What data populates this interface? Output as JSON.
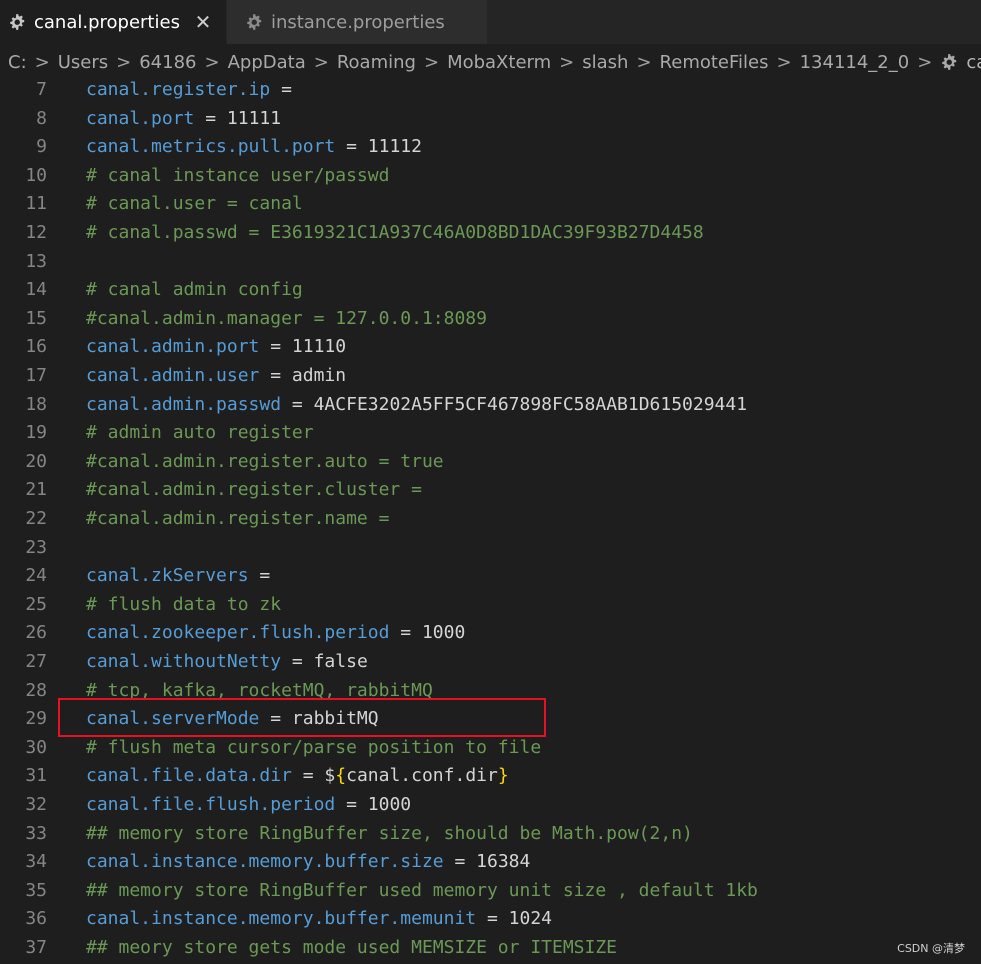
{
  "tabs": [
    {
      "label": "canal.properties",
      "active": true,
      "icon": "gear-icon",
      "close": "✕"
    },
    {
      "label": "instance.properties",
      "active": false,
      "icon": "gear-icon"
    }
  ],
  "breadcrumb": [
    "C:",
    "Users",
    "64186",
    "AppData",
    "Roaming",
    "MobaXterm",
    "slash",
    "RemoteFiles",
    "134114_2_0",
    "canal.proper"
  ],
  "breadcrumb_separator": ">",
  "lines": [
    {
      "n": "7",
      "key": "canal.register.ip",
      "eq": " =",
      "val": ""
    },
    {
      "n": "8",
      "key": "canal.port",
      "eq": " = ",
      "val": "11111"
    },
    {
      "n": "9",
      "key": "canal.metrics.pull.port",
      "eq": " = ",
      "val": "11112"
    },
    {
      "n": "10",
      "comment": "# canal instance user/passwd"
    },
    {
      "n": "11",
      "comment": "# canal.user = canal"
    },
    {
      "n": "12",
      "comment": "# canal.passwd = E3619321C1A937C46A0D8BD1DAC39F93B27D4458"
    },
    {
      "n": "13"
    },
    {
      "n": "14",
      "comment": "# canal admin config"
    },
    {
      "n": "15",
      "comment": "#canal.admin.manager = 127.0.0.1:8089"
    },
    {
      "n": "16",
      "key": "canal.admin.port",
      "eq": " = ",
      "val": "11110"
    },
    {
      "n": "17",
      "key": "canal.admin.user",
      "eq": " = ",
      "val": "admin"
    },
    {
      "n": "18",
      "key": "canal.admin.passwd",
      "eq": " = ",
      "val": "4ACFE3202A5FF5CF467898FC58AAB1D615029441"
    },
    {
      "n": "19",
      "comment": "# admin auto register"
    },
    {
      "n": "20",
      "comment": "#canal.admin.register.auto = true"
    },
    {
      "n": "21",
      "comment": "#canal.admin.register.cluster ="
    },
    {
      "n": "22",
      "comment": "#canal.admin.register.name ="
    },
    {
      "n": "23"
    },
    {
      "n": "24",
      "key": "canal.zkServers",
      "eq": " =",
      "val": ""
    },
    {
      "n": "25",
      "comment": "# flush data to zk"
    },
    {
      "n": "26",
      "key": "canal.zookeeper.flush.period",
      "eq": " = ",
      "val": "1000"
    },
    {
      "n": "27",
      "key": "canal.withoutNetty",
      "eq": " = ",
      "val": "false"
    },
    {
      "n": "28",
      "comment": "# tcp, kafka, rocketMQ, rabbitMQ"
    },
    {
      "n": "29",
      "key": "canal.serverMode",
      "eq": " = ",
      "val": "rabbitMQ"
    },
    {
      "n": "30",
      "comment": "# flush meta cursor/parse position to file"
    },
    {
      "n": "31",
      "key": "canal.file.data.dir",
      "eq": " = ",
      "val": "${canal.conf.dir}",
      "brace": true
    },
    {
      "n": "32",
      "key": "canal.file.flush.period",
      "eq": " = ",
      "val": "1000"
    },
    {
      "n": "33",
      "comment": "## memory store RingBuffer size, should be Math.pow(2,n)"
    },
    {
      "n": "34",
      "key": "canal.instance.memory.buffer.size",
      "eq": " = ",
      "val": "16384"
    },
    {
      "n": "35",
      "comment": "## memory store RingBuffer used memory unit size , default 1kb"
    },
    {
      "n": "36",
      "key": "canal.instance.memory.buffer.memunit",
      "eq": " = ",
      "val": "1024"
    },
    {
      "n": "37",
      "comment": "## meory store gets mode used MEMSIZE or ITEMSIZE"
    }
  ],
  "highlighted_line": "29",
  "watermark": "CSDN @清梦",
  "colors": {
    "key": "#569cd6",
    "comment": "#6a9955",
    "value": "#d4d4d4",
    "highlight": "#e81123"
  }
}
